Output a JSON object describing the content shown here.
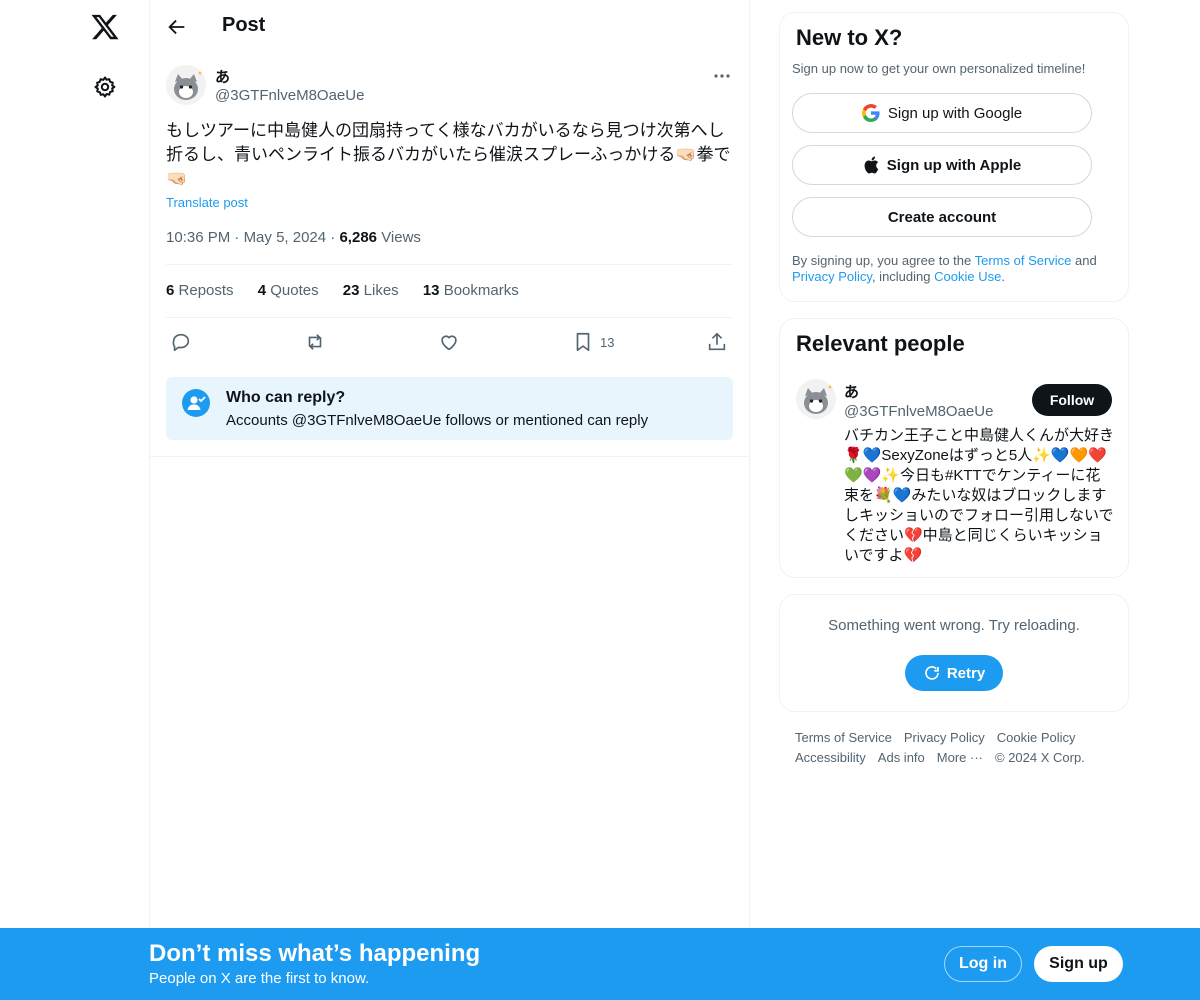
{
  "nav": {
    "logo_icon": "x-logo-icon",
    "settings_icon": "gear-icon"
  },
  "header": {
    "title": "Post",
    "back_icon": "arrow-left-icon"
  },
  "post": {
    "display_name": "あ",
    "handle": "@3GTFnlveM8OaeUe",
    "text": "もしツアーに中島健人の団扇持ってく様なバカがいるなら見つけ次第へし折るし、青いペンライト振るバカがいたら催涙スプレーふっかける🤜🏻拳で🤜🏻",
    "translate_label": "Translate post",
    "time": "10:36 PM",
    "date": "May 5, 2024",
    "views_count": "6,286",
    "views_label": "Views",
    "stats": [
      {
        "count": "6",
        "label": "Reposts"
      },
      {
        "count": "4",
        "label": "Quotes"
      },
      {
        "count": "23",
        "label": "Likes"
      },
      {
        "count": "13",
        "label": "Bookmarks"
      }
    ],
    "bookmark_count": "13",
    "who_can_reply_title": "Who can reply?",
    "who_can_reply_text": "Accounts @3GTFnlveM8OaeUe follows or mentioned can reply"
  },
  "signup_card": {
    "title": "New to X?",
    "subtitle": "Sign up now to get your own personalized timeline!",
    "google_label": "Sign up with Google",
    "apple_label": "Sign up with Apple",
    "create_label": "Create account",
    "legal_prefix": "By signing up, you agree to the ",
    "terms_link": "Terms of Service",
    "legal_and": " and ",
    "privacy_link": "Privacy Policy",
    "legal_including": ", including ",
    "cookie_link": "Cookie Use",
    "legal_end": "."
  },
  "relevant": {
    "title": "Relevant people",
    "name": "あ",
    "handle": "@3GTFnlveM8OaeUe",
    "follow_label": "Follow",
    "bio": "バチカン王子こと中島健人くんが大好き🌹💙SexyZoneはずっと5人✨💙🧡❤️💚💜✨今日も#KTTでケンティーに花束を💐💙みたいな奴はブロックしますしキッショいのでフォロー引用しないでください💔中島と同じくらいキッショいですよ💔"
  },
  "error_card": {
    "message": "Something went wrong. Try reloading.",
    "retry_label": "Retry"
  },
  "footer": {
    "links": [
      "Terms of Service",
      "Privacy Policy",
      "Cookie Policy",
      "Accessibility",
      "Ads info",
      "More ···",
      "© 2024 X Corp."
    ]
  },
  "banner": {
    "title": "Don’t miss what’s happening",
    "subtitle": "People on X are the first to know.",
    "login_label": "Log in",
    "signup_label": "Sign up"
  },
  "colors": {
    "accent": "#1d9bf0",
    "text": "#0f1419",
    "muted": "#536471",
    "reply_bg": "#e8f5fd"
  }
}
